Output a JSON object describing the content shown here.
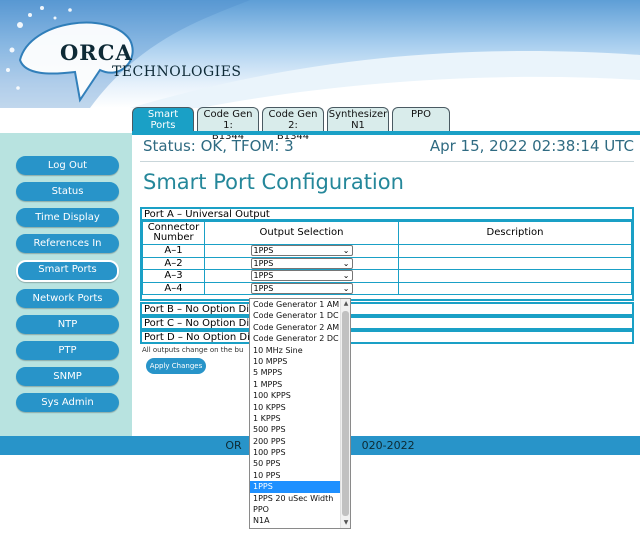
{
  "brand": {
    "name": "ORCA",
    "subtitle": "TECHNOLOGIES"
  },
  "tabs": [
    {
      "label": "Smart\nPorts",
      "active": true
    },
    {
      "label": "Code Gen 1:\nB1344",
      "active": false
    },
    {
      "label": "Code Gen 2:\nB1344",
      "active": false
    },
    {
      "label": "Synthesizer\nN1",
      "active": false
    },
    {
      "label": "PPO",
      "active": false
    }
  ],
  "sidebar": {
    "items": [
      {
        "label": "Log Out"
      },
      {
        "label": "Status"
      },
      {
        "label": "Time Display"
      },
      {
        "label": "References In"
      },
      {
        "label": "Smart Ports",
        "active": true
      },
      {
        "label": "Network Ports"
      },
      {
        "label": "NTP"
      },
      {
        "label": "PTP"
      },
      {
        "label": "SNMP"
      },
      {
        "label": "Sys Admin"
      }
    ]
  },
  "status": {
    "text": "Status: OK, TFOM: 3",
    "datetime": "Apr 15, 2022 02:38:14 UTC"
  },
  "page_title": "Smart Port Configuration",
  "port_a": {
    "title": "Port A – Universal Output",
    "headers": {
      "connector": "Connector\nNumber",
      "output": "Output Selection",
      "description": "Description"
    },
    "rows": [
      {
        "connector": "A–1",
        "output": "1PPS",
        "description": ""
      },
      {
        "connector": "A–2",
        "output": "1PPS",
        "description": ""
      },
      {
        "connector": "A–3",
        "output": "1PPS",
        "description": ""
      },
      {
        "connector": "A–4",
        "output": "1PPS",
        "description": ""
      }
    ]
  },
  "port_b": {
    "title": "Port B – No Option Dis"
  },
  "port_c": {
    "title": "Port C – No Option Dis"
  },
  "port_d": {
    "title": "Port D – No Option Dis"
  },
  "note": "All outputs change on the bu",
  "apply_label": "Apply Changes",
  "footer": {
    "left": "OR",
    "right": "020-2022"
  },
  "dropdown": {
    "options": [
      "Code Generator 1 AM",
      "Code Generator 1 DC",
      "Code Generator 2 AM",
      "Code Generator 2 DC",
      "10 MHz Sine",
      "10 MPPS",
      "5 MPPS",
      "1 MPPS",
      "100 KPPS",
      "10 KPPS",
      "1 KPPS",
      "500 PPS",
      "200 PPS",
      "100 PPS",
      "50 PPS",
      "10 PPS",
      "1PPS",
      "1PPS 20 uSec Width",
      "PPO",
      "N1A"
    ],
    "selected": "1PPS"
  },
  "colors": {
    "accent": "#1aa0c6",
    "button": "#2894c9",
    "sidebar_bg": "#b8e3e0",
    "title": "#25879a"
  }
}
